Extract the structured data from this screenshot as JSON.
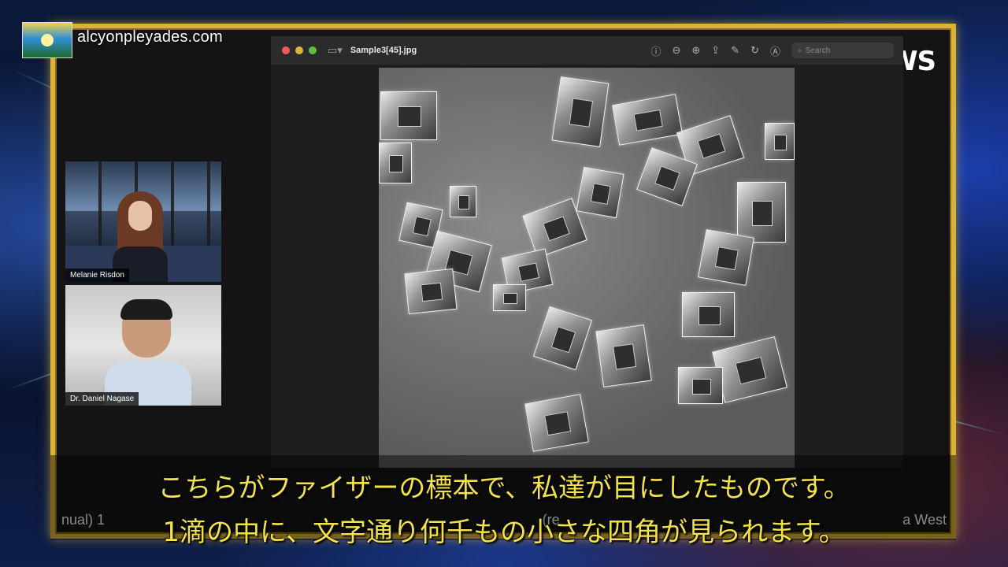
{
  "overlay": {
    "site": "alcyonpleyades.com",
    "channel_logo": "WS"
  },
  "viewer": {
    "filename": "Sample3[45].jpg",
    "search_placeholder": "Search",
    "icons": [
      "sidebar-icon",
      "info-icon",
      "zoom-out-icon",
      "zoom-in-icon",
      "share-icon",
      "markup-icon",
      "rotate-icon",
      "annotate-icon",
      "search-icon"
    ]
  },
  "participants": [
    {
      "name": "Melanie Risdon"
    },
    {
      "name": "Dr. Daniel Nagase"
    }
  ],
  "subtitles": {
    "line1": "こちらがファイザーの標本で、私達が目にしたものです。",
    "line2": "1滴の中に、文字通り何千もの小さな四角が見られます。"
  },
  "background_caption": {
    "left": "nual) 1",
    "middle": "(re",
    "right": "a West"
  },
  "colors": {
    "frame": "#d9b23a",
    "subtitle": "#f3e24a"
  }
}
